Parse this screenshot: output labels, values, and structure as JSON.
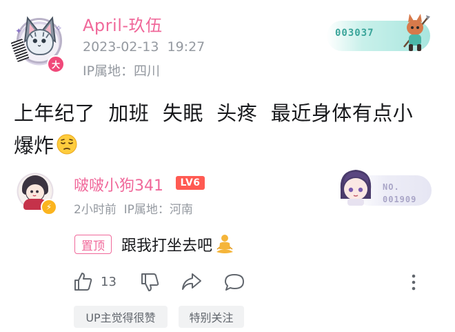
{
  "post": {
    "author": {
      "name": "April-玖伍",
      "avatar_badge": "大",
      "fan_badge_number": "003037"
    },
    "timestamp": "2023-02-13  19:27",
    "ip_location": "IP属地：四川",
    "content_line1": "上年纪了  加班  失眠  头疼  最近身体有点小",
    "content_line2": "爆炸",
    "content_emoji": "pensive-face-emoji"
  },
  "reply": {
    "author": {
      "name": "啵啵小狗341",
      "level": "LV6",
      "fan_badge_label": "NO.",
      "fan_badge_number": "001909"
    },
    "meta": "2小时前  IP属地：河南",
    "pinned_label": "置顶",
    "text": "跟我打坐去吧",
    "text_emoji": "meditating-person-emoji",
    "likes": "13",
    "tags": [
      "UP主觉得很赞",
      "特别关注"
    ]
  },
  "colors": {
    "username_pink": "#f0689a",
    "secondary_text": "#9499a0",
    "level_red": "#ff5a52",
    "chip_bg": "#f1f2f3"
  },
  "icons": {
    "like": "thumbs-up-icon",
    "dislike": "thumbs-down-icon",
    "share": "share-icon",
    "comment": "comment-icon",
    "more": "more-vertical-icon"
  }
}
